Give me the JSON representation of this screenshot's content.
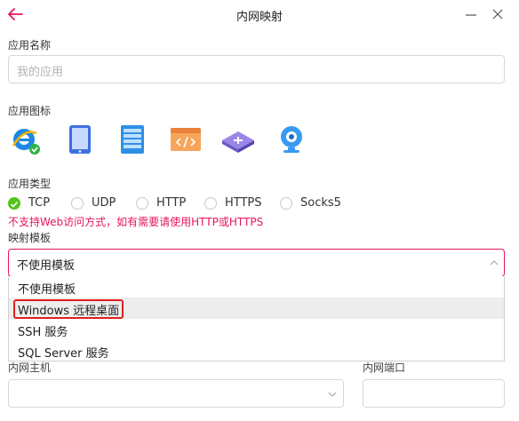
{
  "window": {
    "title": "内网映射"
  },
  "app_name": {
    "label": "应用名称",
    "placeholder": "我的应用"
  },
  "app_icon": {
    "label": "应用图标",
    "icons": [
      "ie-icon",
      "tablet-icon",
      "server-icon",
      "code-window-icon",
      "router-icon",
      "webcam-icon"
    ]
  },
  "app_type": {
    "label": "应用类型",
    "options": [
      "TCP",
      "UDP",
      "HTTP",
      "HTTPS",
      "Socks5"
    ],
    "selected": "TCP",
    "warning": "不支持Web访问方式，如有需要请使用HTTP或HTTPS"
  },
  "template": {
    "label": "映射模板",
    "value": "不使用模板",
    "options": [
      "不使用模板",
      "Windows 远程桌面",
      "SSH 服务",
      "SQL Server 服务"
    ]
  },
  "lan": {
    "host_label": "内网主机",
    "port_label": "内网端口"
  },
  "colors": {
    "accent": "#e8145c",
    "check": "#52c41a",
    "highlight": "#e02020"
  }
}
